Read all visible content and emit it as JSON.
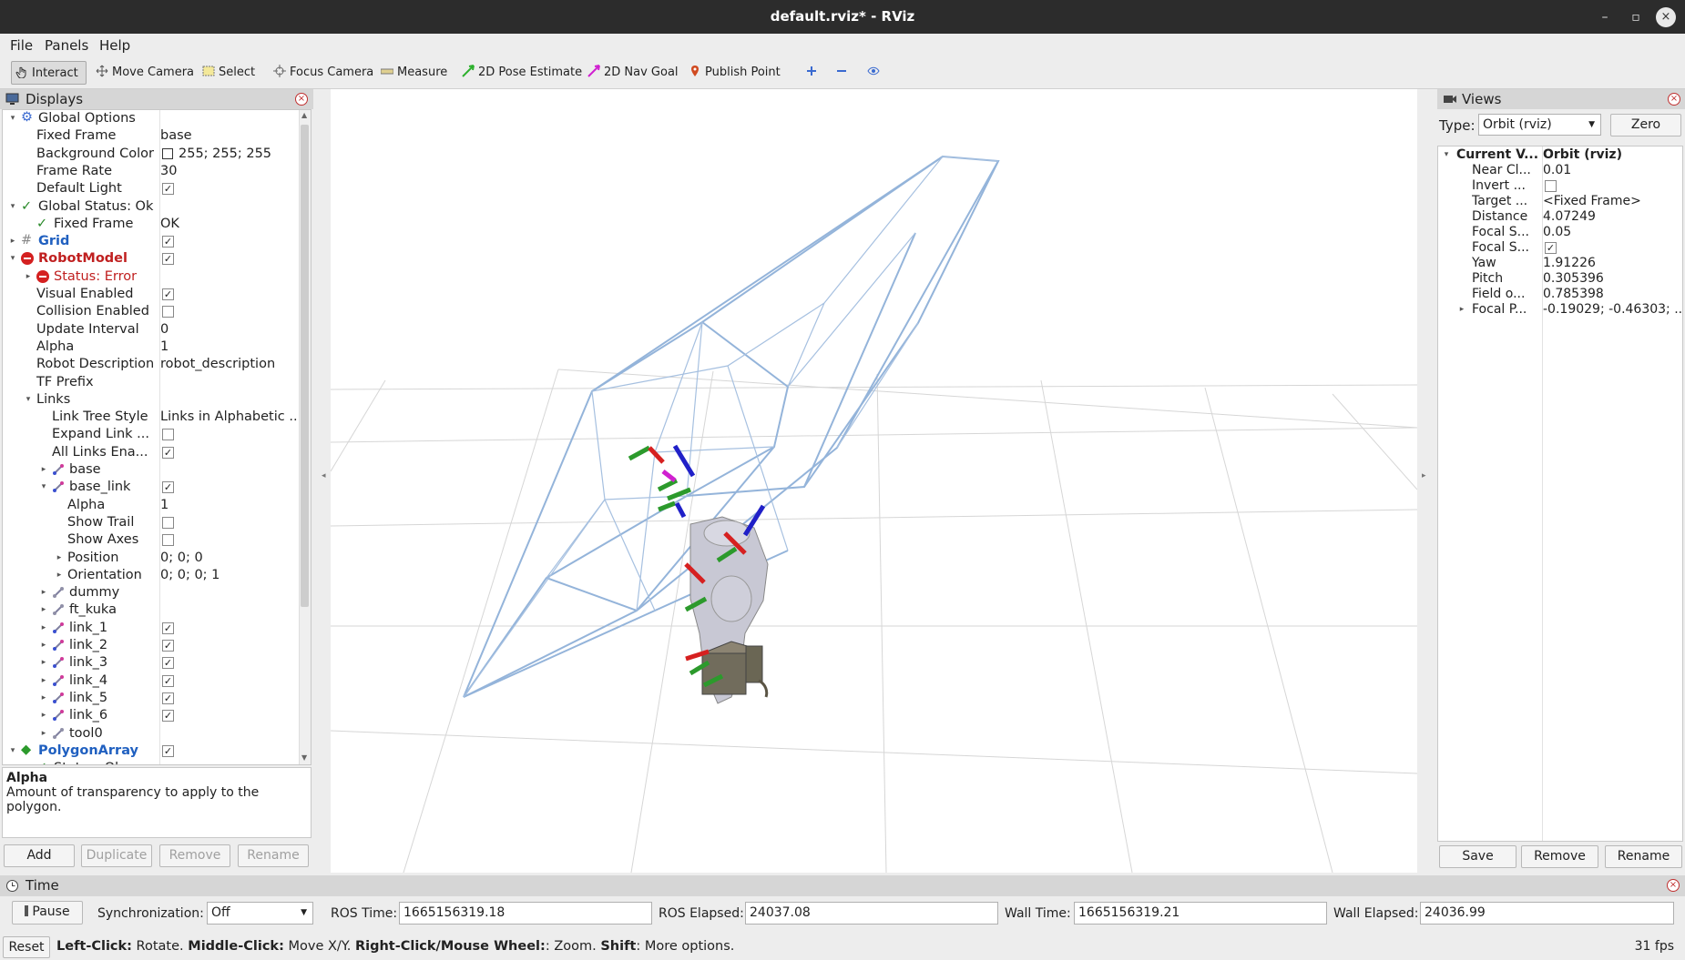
{
  "window": {
    "title": "default.rviz* - RViz",
    "minimize": "–",
    "maximize": "▫",
    "close": "×"
  },
  "menu": {
    "file": "File",
    "panels": "Panels",
    "help": "Help"
  },
  "toolbar": {
    "interact": "Interact",
    "move_camera": "Move Camera",
    "select": "Select",
    "focus_camera": "Focus Camera",
    "measure": "Measure",
    "pose_estimate": "2D Pose Estimate",
    "nav_goal": "2D Nav Goal",
    "publish_point": "Publish Point"
  },
  "displays": {
    "header": "Displays",
    "rows": [
      {
        "label": "Global Options",
        "value": ""
      },
      {
        "label": "Fixed Frame",
        "value": "base"
      },
      {
        "label": "Background Color",
        "value": "255; 255; 255"
      },
      {
        "label": "Frame Rate",
        "value": "30"
      },
      {
        "label": "Default Light",
        "value": ""
      },
      {
        "label": "Global Status: Ok",
        "value": ""
      },
      {
        "label": "Fixed Frame",
        "value": "OK"
      },
      {
        "label": "Grid",
        "value": ""
      },
      {
        "label": "RobotModel",
        "value": ""
      },
      {
        "label": "Status: Error",
        "value": ""
      },
      {
        "label": "Visual Enabled",
        "value": ""
      },
      {
        "label": "Collision Enabled",
        "value": ""
      },
      {
        "label": "Update Interval",
        "value": "0"
      },
      {
        "label": "Alpha",
        "value": "1"
      },
      {
        "label": "Robot Description",
        "value": "robot_description"
      },
      {
        "label": "TF Prefix",
        "value": ""
      },
      {
        "label": "Links",
        "value": ""
      },
      {
        "label": "Link Tree Style",
        "value": "Links in Alphabetic ..."
      },
      {
        "label": "Expand Link ...",
        "value": ""
      },
      {
        "label": "All Links Ena...",
        "value": ""
      },
      {
        "label": "base",
        "value": ""
      },
      {
        "label": "base_link",
        "value": ""
      },
      {
        "label": "Alpha",
        "value": "1"
      },
      {
        "label": "Show Trail",
        "value": ""
      },
      {
        "label": "Show Axes",
        "value": ""
      },
      {
        "label": "Position",
        "value": "0; 0; 0"
      },
      {
        "label": "Orientation",
        "value": "0; 0; 0; 1"
      },
      {
        "label": "dummy",
        "value": ""
      },
      {
        "label": "ft_kuka",
        "value": ""
      },
      {
        "label": "link_1",
        "value": ""
      },
      {
        "label": "link_2",
        "value": ""
      },
      {
        "label": "link_3",
        "value": ""
      },
      {
        "label": "link_4",
        "value": ""
      },
      {
        "label": "link_5",
        "value": ""
      },
      {
        "label": "link_6",
        "value": ""
      },
      {
        "label": "tool0",
        "value": ""
      },
      {
        "label": "PolygonArray",
        "value": ""
      },
      {
        "label": "Status: Ok",
        "value": ""
      }
    ],
    "desc_title": "Alpha",
    "desc_text": "Amount of transparency to apply to the polygon.",
    "buttons": {
      "add": "Add",
      "duplicate": "Duplicate",
      "remove": "Remove",
      "rename": "Rename"
    }
  },
  "views": {
    "header": "Views",
    "type_label": "Type:",
    "type_value": "Orbit (rviz)",
    "zero": "Zero",
    "rows": [
      {
        "label": "Current V...",
        "value": "Orbit (rviz)"
      },
      {
        "label": "Near Cl...",
        "value": "0.01"
      },
      {
        "label": "Invert ...",
        "value": ""
      },
      {
        "label": "Target ...",
        "value": "<Fixed Frame>"
      },
      {
        "label": "Distance",
        "value": "4.07249"
      },
      {
        "label": "Focal S...",
        "value": "0.05"
      },
      {
        "label": "Focal S...",
        "value": ""
      },
      {
        "label": "Yaw",
        "value": "1.91226"
      },
      {
        "label": "Pitch",
        "value": "0.305396"
      },
      {
        "label": "Field o...",
        "value": "0.785398"
      },
      {
        "label": "Focal P...",
        "value": "-0.19029; -0.46303; ..."
      }
    ],
    "buttons": {
      "save": "Save",
      "remove": "Remove",
      "rename": "Rename"
    }
  },
  "time": {
    "header": "Time",
    "pause": "Pause",
    "sync_label": "Synchronization:",
    "sync_value": "Off",
    "ros_time_label": "ROS Time:",
    "ros_time": "1665156319.18",
    "ros_elapsed_label": "ROS Elapsed:",
    "ros_elapsed": "24037.08",
    "wall_time_label": "Wall Time:",
    "wall_time": "1665156319.21",
    "wall_elapsed_label": "Wall Elapsed:",
    "wall_elapsed": "24036.99"
  },
  "status": {
    "reset": "Reset",
    "k1": "Left-Click:",
    "t1": " Rotate. ",
    "k2": "Middle-Click:",
    "t2": " Move X/Y. ",
    "k3": "Right-Click/Mouse Wheel:",
    "t3": ": Zoom. ",
    "k4": "Shift",
    "t4": ": More options.",
    "fps": "31 fps"
  }
}
